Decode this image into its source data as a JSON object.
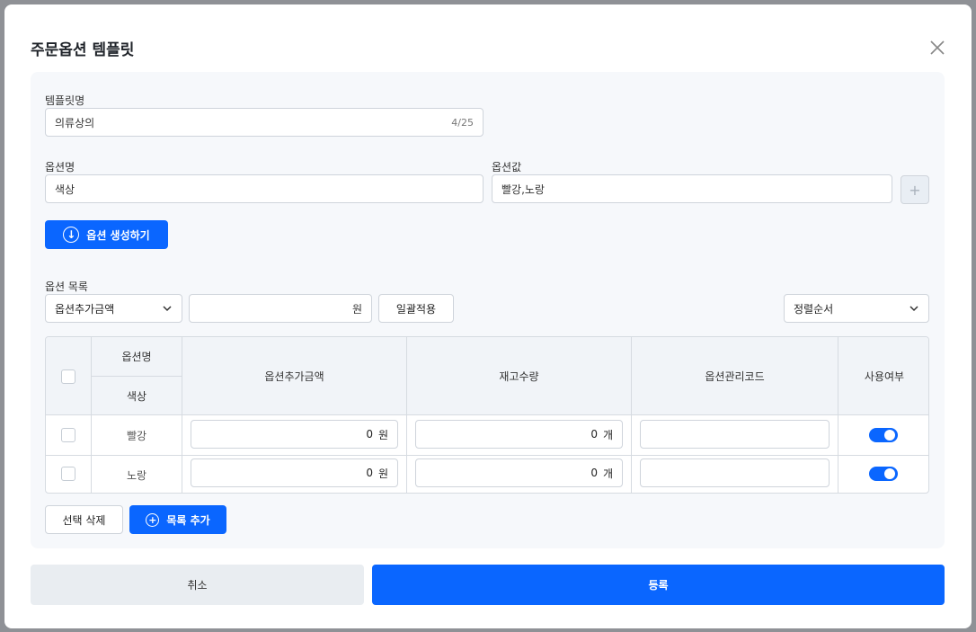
{
  "modal": {
    "title": "주문옵션 템플릿"
  },
  "template_name": {
    "label": "템플릿명",
    "value": "의류상의",
    "counter": "4/25"
  },
  "option_name": {
    "label": "옵션명",
    "value": "색상"
  },
  "option_values": {
    "label": "옵션값",
    "value": "빨강,노랑",
    "plus_icon": "plus-icon"
  },
  "generate_button": {
    "label": "옵션 생성하기"
  },
  "option_list": {
    "label": "옵션 목록",
    "field_select": "옵션추가금액",
    "bulk_unit": "원",
    "bulk_apply_label": "일괄적용",
    "sort_select": "정렬순서"
  },
  "table": {
    "headers": {
      "option_name": "옵션명",
      "option_name_sub": "색상",
      "extra_price": "옵션추가금액",
      "stock": "재고수량",
      "code": "옵션관리코드",
      "enabled": "사용여부"
    },
    "rows": [
      {
        "name": "빨강",
        "price": "0",
        "price_unit": "원",
        "stock": "0",
        "stock_unit": "개",
        "code": "",
        "enabled": true
      },
      {
        "name": "노랑",
        "price": "0",
        "price_unit": "원",
        "stock": "0",
        "stock_unit": "개",
        "code": "",
        "enabled": true
      }
    ]
  },
  "actions": {
    "delete_selected": "선택 삭제",
    "add_row": "목록 추가"
  },
  "footer": {
    "cancel": "취소",
    "submit": "등록"
  },
  "colors": {
    "primary": "#0a66ff",
    "panel": "#f6f8fb",
    "backdrop": "#8f9196"
  }
}
